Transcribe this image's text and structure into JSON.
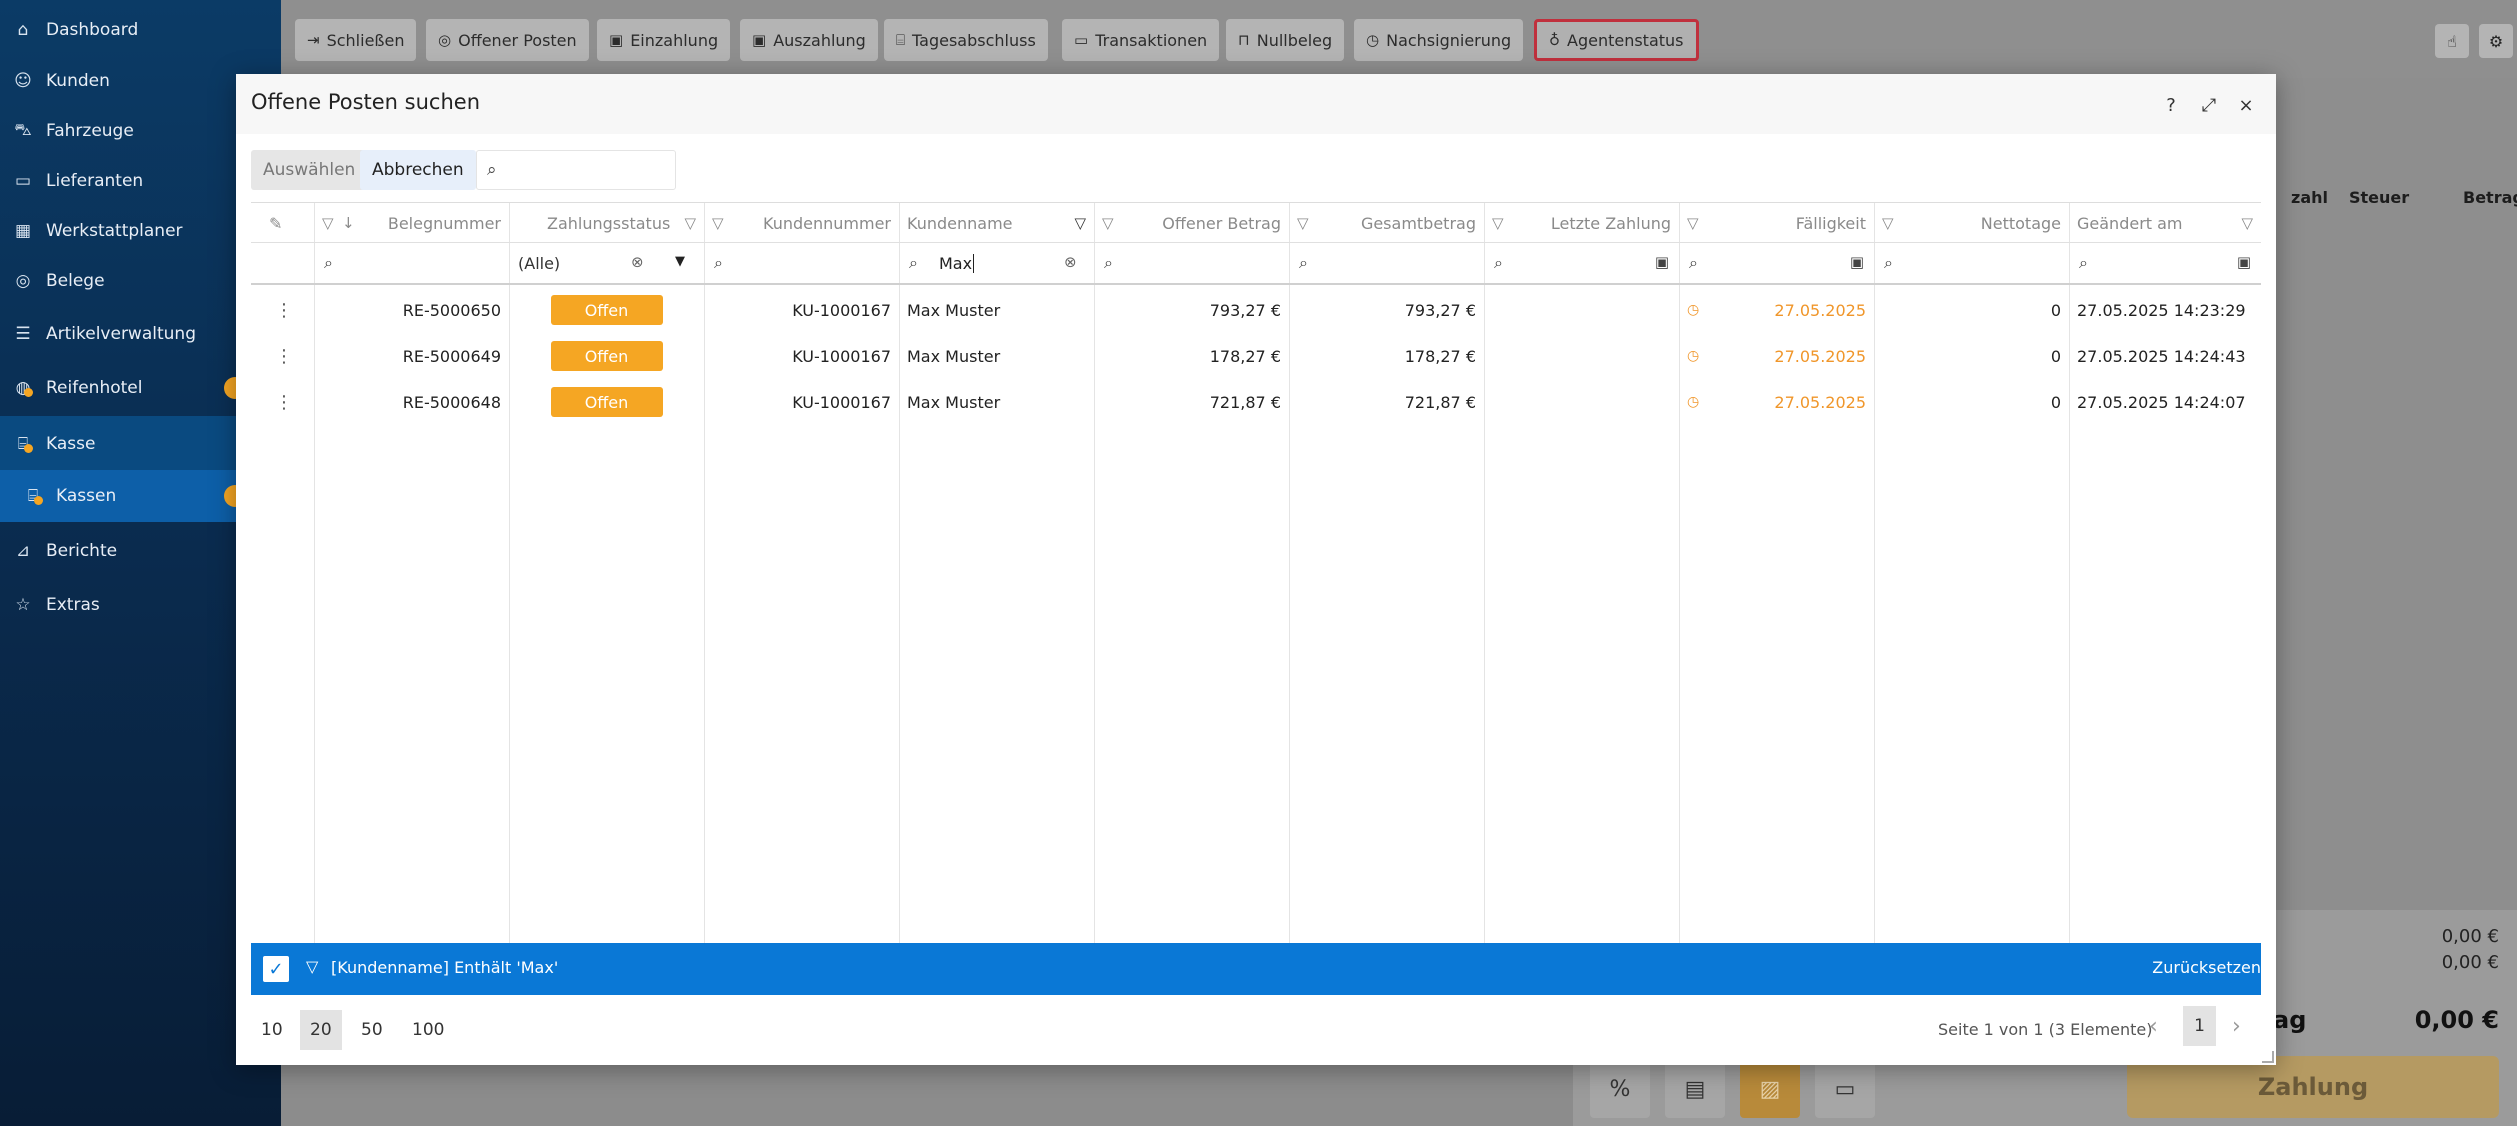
{
  "sidebar": {
    "items": [
      {
        "label": "Dashboard",
        "icon": "home-icon"
      },
      {
        "label": "Kunden",
        "icon": "user-icon"
      },
      {
        "label": "Fahrzeuge",
        "icon": "car-icon"
      },
      {
        "label": "Lieferanten",
        "icon": "truck-icon"
      },
      {
        "label": "Werkstattplaner",
        "icon": "calendar-icon"
      },
      {
        "label": "Belege",
        "icon": "coins-icon"
      },
      {
        "label": "Artikelverwaltung",
        "icon": "list-icon"
      },
      {
        "label": "Reifenhotel",
        "icon": "tire-icon"
      },
      {
        "label": "Kasse",
        "icon": "register-icon"
      },
      {
        "label": "Kassen",
        "icon": "register-icon"
      },
      {
        "label": "Berichte",
        "icon": "chart-icon"
      },
      {
        "label": "Extras",
        "icon": "star-icon"
      }
    ]
  },
  "toolbar": {
    "buttons": [
      "Schließen",
      "Offener Posten",
      "Einzahlung",
      "Auszahlung",
      "Tagesabschluss",
      "Transaktionen",
      "Nullbeleg",
      "Nachsignierung",
      "Agentenstatus"
    ]
  },
  "background": {
    "columns": [
      "zahl",
      "Steuer",
      "Betrag"
    ],
    "totals": [
      "0,00 €",
      "0,00 €"
    ],
    "total_label": "ag",
    "total_value": "0,00 €",
    "pay_button": "Zahlung"
  },
  "modal": {
    "title": "Offene Posten suchen",
    "select_button": "Auswählen",
    "cancel_button": "Abbrechen",
    "search_value": "",
    "columns": [
      "Belegnummer",
      "Zahlungsstatus",
      "Kundennummer",
      "Kundenname",
      "Offener Betrag",
      "Gesamtbetrag",
      "Letzte Zahlung",
      "Fälligkeit",
      "Nettotage",
      "Geändert am"
    ],
    "status_filter": "(Alle)",
    "name_filter": "Max",
    "rows": [
      {
        "beleg": "RE-5000650",
        "status": "Offen",
        "kundennr": "KU-1000167",
        "name": "Max Muster",
        "offen": "793,27 €",
        "gesamt": "793,27 €",
        "letzte": "",
        "faellig": "27.05.2025",
        "netto": "0",
        "geaendert": "27.05.2025 14:23:29"
      },
      {
        "beleg": "RE-5000649",
        "status": "Offen",
        "kundennr": "KU-1000167",
        "name": "Max Muster",
        "offen": "178,27 €",
        "gesamt": "178,27 €",
        "letzte": "",
        "faellig": "27.05.2025",
        "netto": "0",
        "geaendert": "27.05.2025 14:24:43"
      },
      {
        "beleg": "RE-5000648",
        "status": "Offen",
        "kundennr": "KU-1000167",
        "name": "Max Muster",
        "offen": "721,87 €",
        "gesamt": "721,87 €",
        "letzte": "",
        "faellig": "27.05.2025",
        "netto": "0",
        "geaendert": "27.05.2025 14:24:07"
      }
    ],
    "filter_bar_text": "[Kundenname] Enthält 'Max'",
    "reset_label": "Zurücksetzen",
    "page_sizes": [
      "10",
      "20",
      "50",
      "100"
    ],
    "selected_page_size": "20",
    "page_info": "Seite 1 von 1 (3 Elemente)",
    "current_page": "1"
  },
  "colors": {
    "accent": "#0a78d6",
    "status_open": "#f5a623",
    "sidebar": "#0b3b66",
    "highlight": "#c0303d"
  }
}
